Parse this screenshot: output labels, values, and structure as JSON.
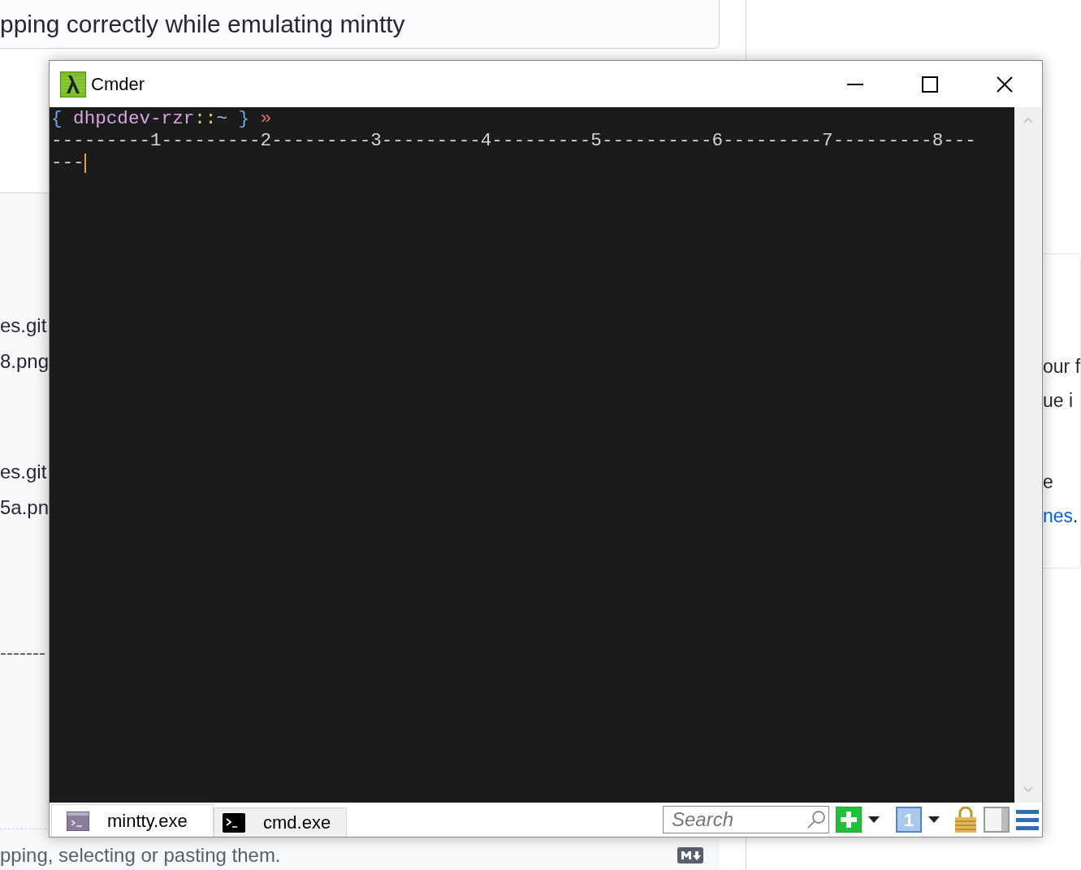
{
  "page": {
    "title_field": "pping correctly while emulating mintty",
    "body_lines": [
      "es.git",
      "8.png",
      "es.git",
      "5a.pn"
    ],
    "ruler_line": "-------",
    "footer_hint": "pping, selecting or pasting them.",
    "welcome": {
      "lines": [
        "our f",
        "ue i",
        "e"
      ],
      "review_link": "nes",
      "review_suffix": "."
    }
  },
  "window": {
    "title": "Cmder",
    "prompt": [
      {
        "text": "{",
        "color": "#6ea8e6"
      },
      {
        "text": " dhpcdev-rzr",
        "color": "#d5a6e0"
      },
      {
        "text": "::",
        "color": "#e5d28a"
      },
      {
        "text": "~",
        "color": "#8fc3ee"
      },
      {
        "text": " }",
        "color": "#6ea8e6"
      },
      {
        "text": " »",
        "color": "#e0706a"
      }
    ],
    "output": [
      "---------1---------2---------3---------4---------5----------6---------7---------8---",
      "---"
    ],
    "tabs": [
      {
        "label": "mintty.exe",
        "selected": true,
        "kind": "mintty"
      },
      {
        "label": "cmd.exe",
        "selected": false,
        "kind": "cmd"
      }
    ],
    "search": {
      "placeholder": "Search"
    },
    "console_number": "1"
  }
}
